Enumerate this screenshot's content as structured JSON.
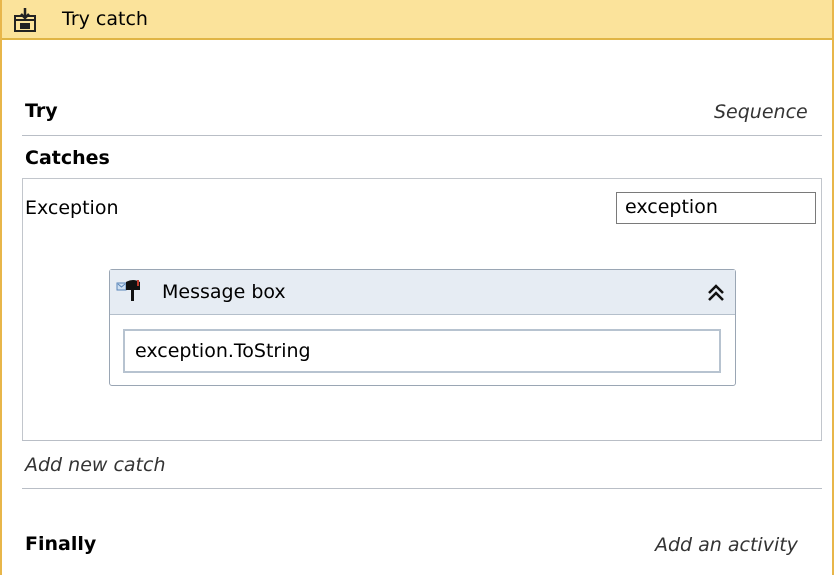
{
  "header": {
    "title": "Try catch",
    "icon": "try-catch-icon",
    "background": "#fbe39b",
    "border": "#e0b545"
  },
  "try": {
    "label": "Try",
    "placeholder_link": "Sequence"
  },
  "catches": {
    "label": "Catches",
    "items": [
      {
        "exception_type": "Exception",
        "variable_name": "exception",
        "activity": {
          "title": "Message box",
          "icon": "message-box-icon",
          "collapse_icon": "double-chevron-up-icon",
          "text_value": "exception.ToString"
        }
      }
    ],
    "add_link": "Add new catch"
  },
  "finally": {
    "label": "Finally",
    "add_link": "Add an activity"
  }
}
